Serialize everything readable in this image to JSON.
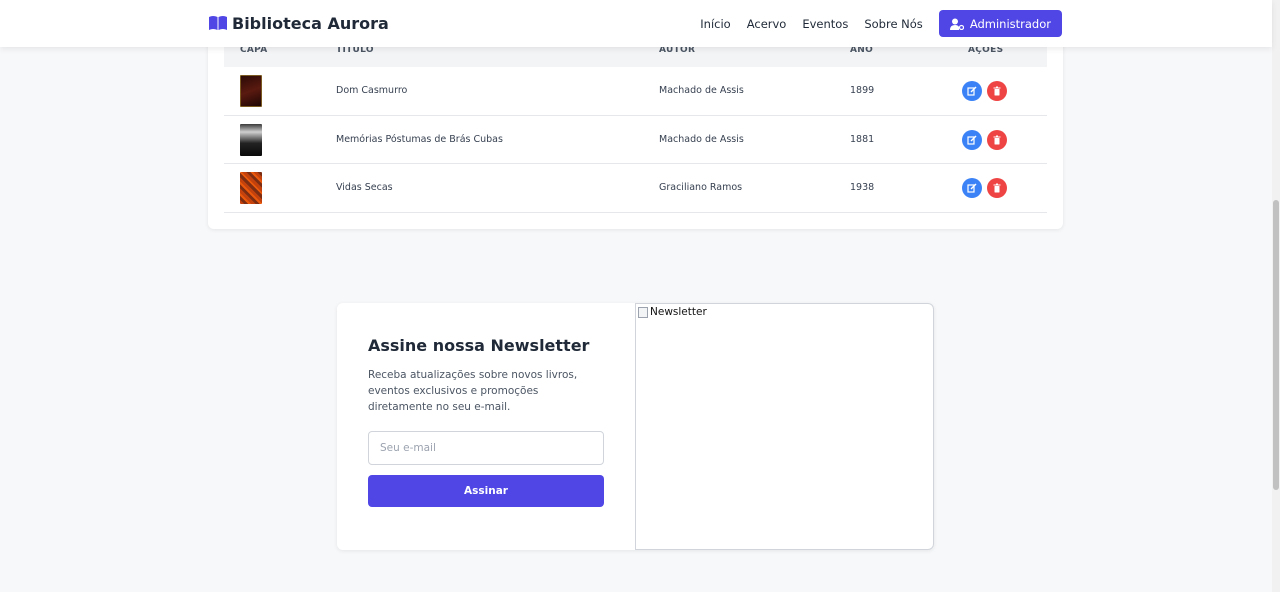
{
  "header": {
    "brand": "Biblioteca Aurora",
    "nav": [
      "Início",
      "Acervo",
      "Eventos",
      "Sobre Nós"
    ],
    "admin_label": "Administrador"
  },
  "table": {
    "columns": [
      "CAPA",
      "TÍTULO",
      "AUTOR",
      "ANO",
      "AÇÕES"
    ],
    "rows": [
      {
        "title": "Dom Casmurro",
        "author": "Machado de Assis",
        "year": "1899"
      },
      {
        "title": "Memórias Póstumas de Brás Cubas",
        "author": "Machado de Assis",
        "year": "1881"
      },
      {
        "title": "Vidas Secas",
        "author": "Graciliano Ramos",
        "year": "1938"
      }
    ]
  },
  "newsletter": {
    "title": "Assine nossa Newsletter",
    "description": "Receba atualizações sobre novos livros, eventos exclusivos e promoções diretamente no seu e-mail.",
    "email_placeholder": "Seu e-mail",
    "email_value": "",
    "button_label": "Assinar",
    "image_alt": "Newsletter"
  },
  "colors": {
    "primary": "#4f46e5",
    "edit": "#3b82f6",
    "delete": "#ef4444"
  }
}
